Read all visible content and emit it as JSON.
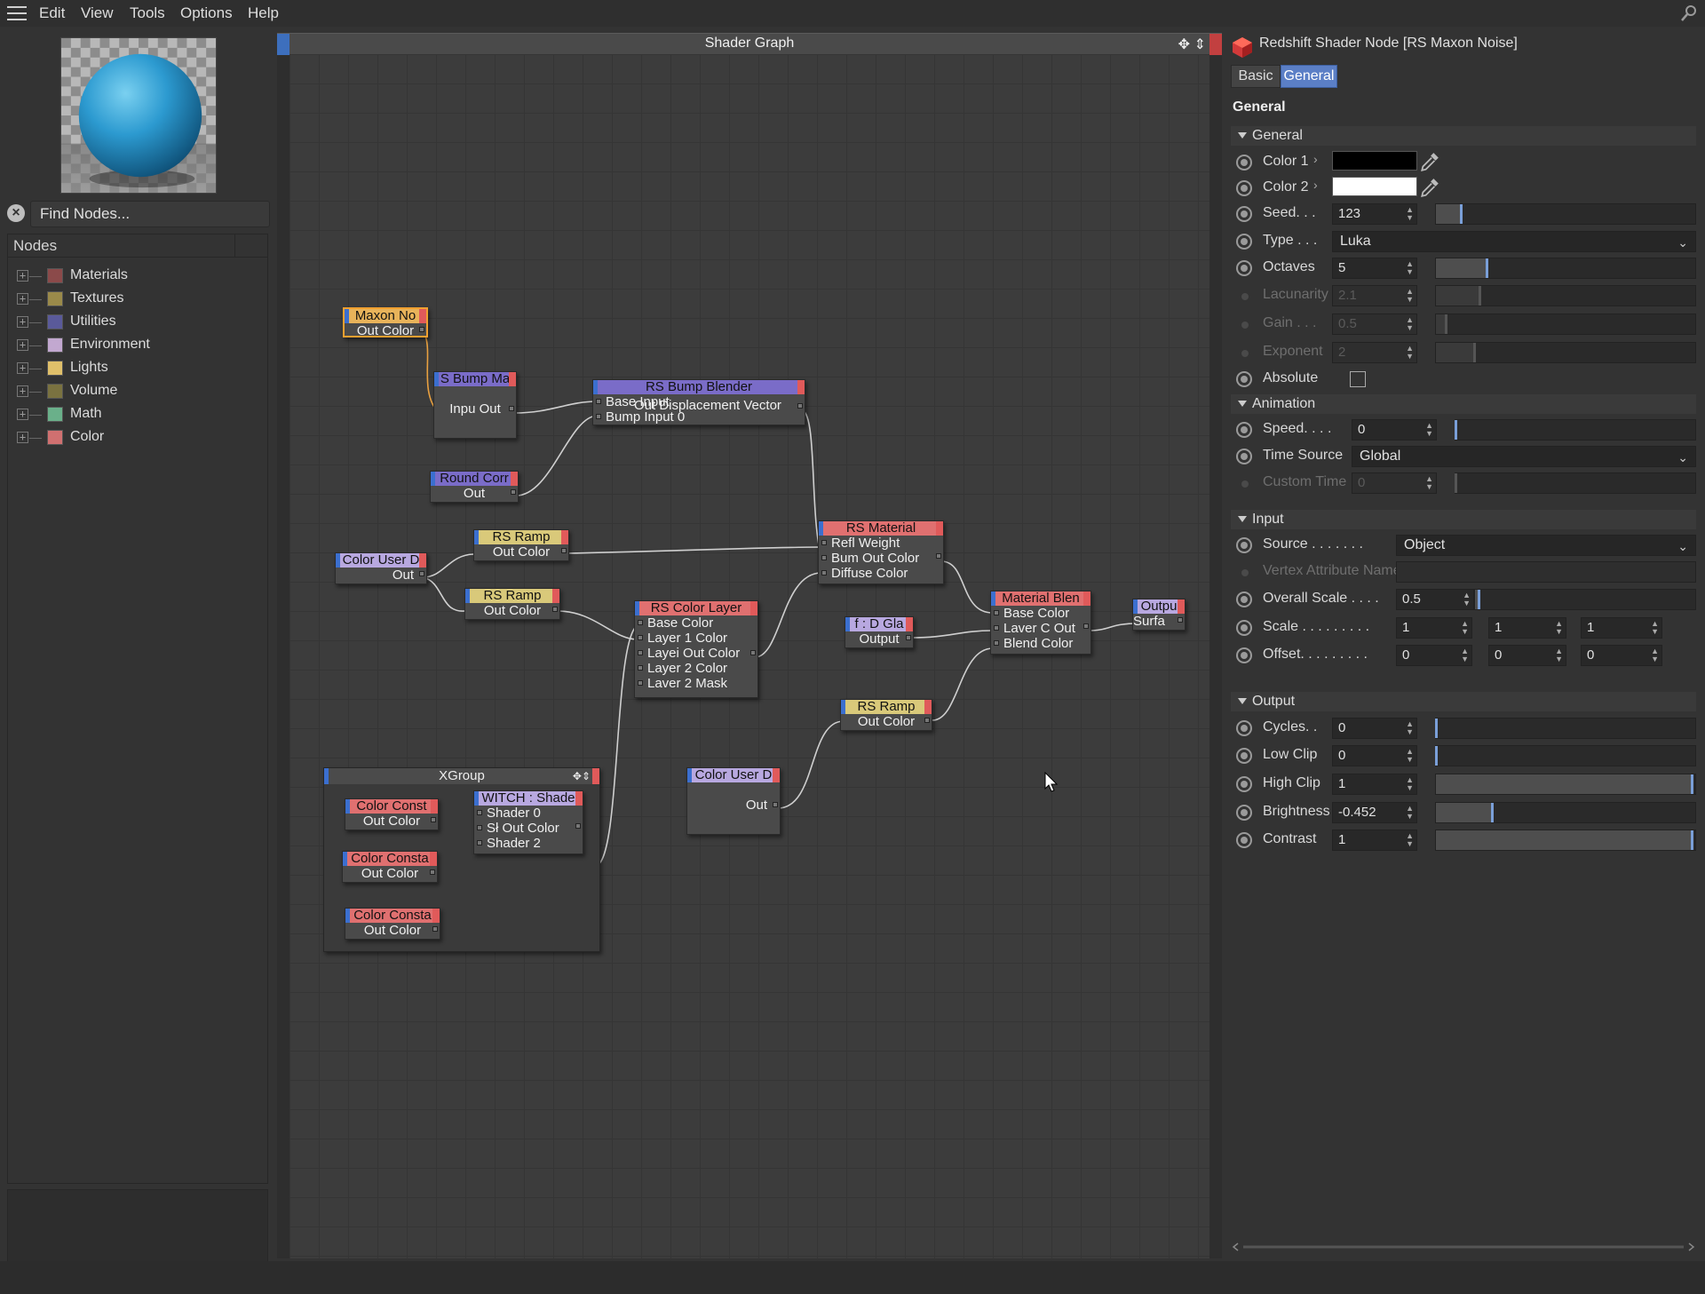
{
  "menu": {
    "items": [
      "Edit",
      "View",
      "Tools",
      "Options",
      "Help"
    ]
  },
  "find": {
    "placeholder": "Find Nodes..."
  },
  "nodes_panel": {
    "header": "Nodes",
    "items": [
      {
        "label": "Materials",
        "color": "#8b4a4a"
      },
      {
        "label": "Textures",
        "color": "#9a8a4a"
      },
      {
        "label": "Utilities",
        "color": "#5a5a9a"
      },
      {
        "label": "Environment",
        "color": "#c2a8d0"
      },
      {
        "label": "Lights",
        "color": "#e0c06a"
      },
      {
        "label": "Volume",
        "color": "#7a7240"
      },
      {
        "label": "Math",
        "color": "#6ab08a"
      },
      {
        "label": "Color",
        "color": "#d07070"
      }
    ]
  },
  "graph": {
    "title": "Shader Graph",
    "nodes": {
      "maxon_noise": {
        "title": "Maxon No",
        "rows": [
          "Out Color"
        ],
        "hdr": "#e8b35a"
      },
      "bump_map": {
        "title": "S Bump Ma",
        "rows": [
          "",
          "Inpu Out"
        ],
        "hdr": "#7a6cc8"
      },
      "round_corners": {
        "title": "Round Corr",
        "rows": [
          "Out"
        ],
        "hdr": "#7a6cc8"
      },
      "bump_blender": {
        "title": "RS Bump Blender",
        "rows": [
          "Base Input",
          "Bump Input 0"
        ],
        "overlay": "Out Displacement Vector",
        "hdr": "#7a6cc8"
      },
      "color_user_1": {
        "title": "Color User D",
        "rows": [
          "Out"
        ],
        "hdr": "#b8a8e0"
      },
      "rs_ramp_1": {
        "title": "RS Ramp",
        "rows": [
          "Out Color"
        ],
        "hdr": "#d9c97a"
      },
      "rs_ramp_2": {
        "title": "RS Ramp",
        "rows": [
          "Out Color"
        ],
        "hdr": "#d9c97a"
      },
      "rs_material": {
        "title": "RS Material",
        "rows": [
          "Refl Weight",
          "Bum  Out Color",
          "Diffuse Color"
        ],
        "hdr": "#e07070"
      },
      "rs_color_layer": {
        "title": "RS Color Layer",
        "rows": [
          "Base Color",
          "Layer 1 Color",
          "Layei Out Color",
          "Layer 2 Color",
          "Laver 2 Mask"
        ],
        "hdr": "#e07070"
      },
      "gla_output": {
        "title": "f : D Gla",
        "rows": [
          "Output"
        ],
        "hdr": "#b8a8e0"
      },
      "material_blender": {
        "title": "Material Blen",
        "rows": [
          "Base Color",
          "Laver C Out",
          "Blend Color"
        ],
        "hdr": "#e07070"
      },
      "output": {
        "title": "Outpu",
        "rows": [
          "Surfa"
        ],
        "hdr": "#b8a8e0"
      },
      "rs_ramp_3": {
        "title": "RS Ramp",
        "rows": [
          "Out Color"
        ],
        "hdr": "#d9c97a"
      },
      "color_user_2": {
        "title": "Color User D",
        "rows": [
          "",
          "Out"
        ],
        "hdr": "#b8a8e0"
      },
      "color_const_1": {
        "title": "Color Const",
        "rows": [
          "Out Color"
        ],
        "hdr": "#e07070"
      },
      "color_const_2": {
        "title": "Color Consta",
        "rows": [
          "Out Color"
        ],
        "hdr": "#e07070"
      },
      "color_const_3": {
        "title": "Color Consta",
        "rows": [
          "Out Color"
        ],
        "hdr": "#e07070"
      },
      "switch_shader": {
        "title": "WITCH : Shade",
        "rows": [
          "Shader 0",
          "Sł  Out Color",
          "Shader 2"
        ],
        "hdr": "#b8a8e0"
      }
    },
    "group_title": "XGroup"
  },
  "inspector": {
    "title": "Redshift Shader Node [RS Maxon Noise]",
    "tabs": [
      "Basic",
      "General"
    ],
    "section_title": "General",
    "general": {
      "header": "General",
      "color1_label": "Color 1",
      "color1": "#000000",
      "color2_label": "Color 2",
      "color2": "#ffffff",
      "seed_label": "Seed. . .",
      "seed": "123",
      "type_label": "Type . . .",
      "type": "Luka",
      "octaves_label": "Octaves",
      "octaves": "5",
      "lacunarity_label": "Lacunarity",
      "lacunarity": "2.1",
      "gain_label": "Gain . . .",
      "gain": "0.5",
      "exponent_label": "Exponent",
      "exponent": "2",
      "absolute_label": "Absolute"
    },
    "animation": {
      "header": "Animation",
      "speed_label": "Speed. . . .",
      "speed": "0",
      "time_source_label": "Time Source",
      "time_source": "Global",
      "custom_time_label": "Custom Time",
      "custom_time": "0"
    },
    "input": {
      "header": "Input",
      "source_label": "Source . . . . . . .",
      "source": "Object",
      "vertex_label": "Vertex Attribute Name",
      "overall_scale_label": "Overall Scale . . . .",
      "overall_scale": "0.5",
      "scale_label": "Scale . . . . . . . . .",
      "scale": [
        "1",
        "1",
        "1"
      ],
      "offset_label": "Offset. . . . . . . . .",
      "offset": [
        "0",
        "0",
        "0"
      ]
    },
    "output": {
      "header": "Output",
      "cycles_label": "Cycles. .",
      "cycles": "0",
      "low_clip_label": "Low Clip",
      "low_clip": "0",
      "high_clip_label": "High Clip",
      "high_clip": "1",
      "brightness_label": "Brightness",
      "brightness": "-0.452",
      "contrast_label": "Contrast",
      "contrast": "1"
    }
  }
}
